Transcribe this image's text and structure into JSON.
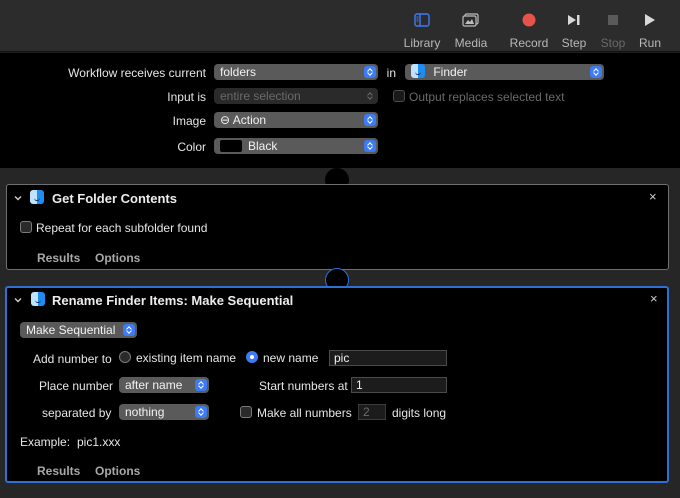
{
  "toolbar": {
    "library": "Library",
    "media": "Media",
    "record": "Record",
    "step": "Step",
    "stop": "Stop",
    "run": "Run",
    "colors": {
      "record": "#e5534b",
      "accent": "#3d7bf5"
    }
  },
  "header": {
    "receives_label": "Workflow receives current",
    "receives_value": "folders",
    "in_label": "in",
    "in_value": "Finder",
    "input_is_label": "Input is",
    "input_is_value": "entire selection",
    "output_replaces_label": "Output replaces selected text",
    "image_label": "Image",
    "image_value": "⊖ Action",
    "color_label": "Color",
    "color_value": "Black"
  },
  "action1": {
    "title": "Get Folder Contents",
    "repeat_label": "Repeat for each subfolder found",
    "results_tab": "Results",
    "options_tab": "Options",
    "close": "×"
  },
  "action2": {
    "title": "Rename Finder Items: Make Sequential",
    "mode_value": "Make Sequential",
    "add_number_label": "Add number to",
    "existing_item_label": "existing item name",
    "new_name_label": "new name",
    "new_name_value": "pic",
    "place_number_label": "Place number",
    "place_number_value": "after name",
    "start_numbers_label": "Start numbers at",
    "start_numbers_value": "1",
    "separated_by_label": "separated by",
    "separated_by_value": "nothing",
    "make_all_label": "Make all numbers",
    "digits_value": "2",
    "digits_long_label": "digits long",
    "example_label": "Example:",
    "example_value": "pic1.xxx",
    "results_tab": "Results",
    "options_tab": "Options",
    "close": "×"
  }
}
